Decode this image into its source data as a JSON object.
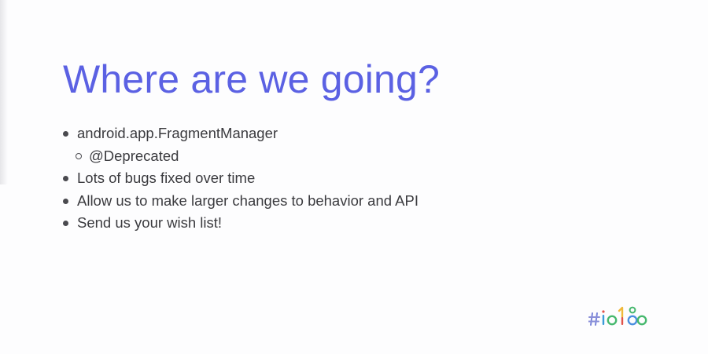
{
  "slide": {
    "title": "Where are we going?",
    "bullets": [
      {
        "text": "android.app.FragmentManager",
        "level": 1
      },
      {
        "text": "@Deprecated",
        "level": 2
      },
      {
        "text": "Lots of bugs fixed over time",
        "level": 1
      },
      {
        "text": "Allow us to make larger changes to behavior and API",
        "level": 1
      },
      {
        "text": "Send us your wish list!",
        "level": 1
      }
    ],
    "logo": {
      "icon": "google-io-18-logo",
      "text": "#io18"
    }
  },
  "colors": {
    "title": "#5b61e3",
    "body_text": "#3b3b3f",
    "logo_hash": "#7b86d9",
    "logo_i": "#3a9bd9",
    "logo_o": "#46b86e",
    "logo_one": "#f0b93a",
    "logo_eight": "#4a8fe0"
  }
}
